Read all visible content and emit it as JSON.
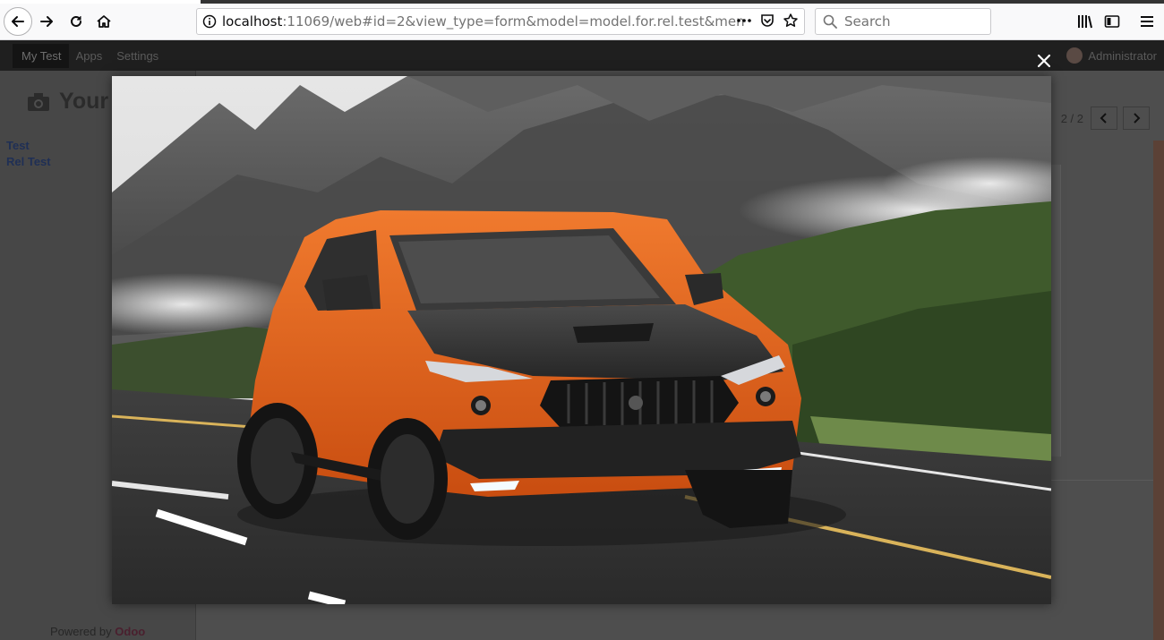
{
  "browser": {
    "url_host": "localhost",
    "url_rest": ":11069/web#id=2&view_type=form&model=model.for.rel.test&menu",
    "search_placeholder": "Search",
    "icons": {
      "back": "back-arrow-icon",
      "forward": "forward-arrow-icon",
      "reload": "reload-icon",
      "home": "home-icon",
      "info": "page-info-icon",
      "more": "more-actions-icon",
      "pocket": "pocket-icon",
      "bookmark": "bookmark-star-icon",
      "library": "library-icon",
      "sidebar": "sidebar-icon",
      "menu": "hamburger-menu-icon"
    }
  },
  "odoo": {
    "menu": [
      "My Test",
      "Apps",
      "Settings"
    ],
    "user": "Administrator",
    "title": "Your",
    "sidebar_items": [
      "Test",
      "Rel Test"
    ],
    "pager": "2 / 2",
    "powered_by": "Powered by",
    "powered_brand": "Odoo"
  },
  "lightbox": {
    "image_subject": "orange SUV on mountain road",
    "close_icon": "close-icon"
  },
  "colors": {
    "car_orange": "#e8601c",
    "overlay": "#4e4e4e",
    "odoo_nav": "#1f1f1f"
  }
}
